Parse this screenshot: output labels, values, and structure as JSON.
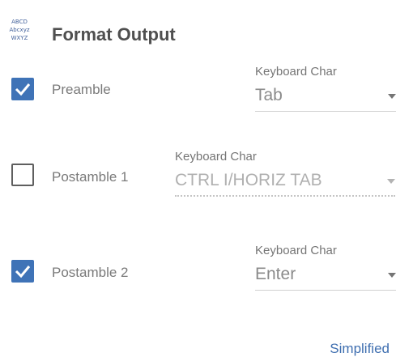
{
  "header": {
    "title": "Format Output",
    "logo_text": [
      "ABCD",
      "Abcxyz",
      "WXYZ"
    ]
  },
  "rows": [
    {
      "label": "Preamble",
      "checked": true,
      "field_label": "Keyboard Char",
      "value": "Tab",
      "disabled": false
    },
    {
      "label": "Postamble 1",
      "checked": false,
      "field_label": "Keyboard Char",
      "value": "CTRL I/HORIZ TAB",
      "disabled": true
    },
    {
      "label": "Postamble 2",
      "checked": true,
      "field_label": "Keyboard Char",
      "value": "Enter",
      "disabled": false
    }
  ],
  "footer": {
    "link": "Simplified"
  },
  "colors": {
    "accent": "#3f73b7",
    "link": "#3f6fb0"
  }
}
